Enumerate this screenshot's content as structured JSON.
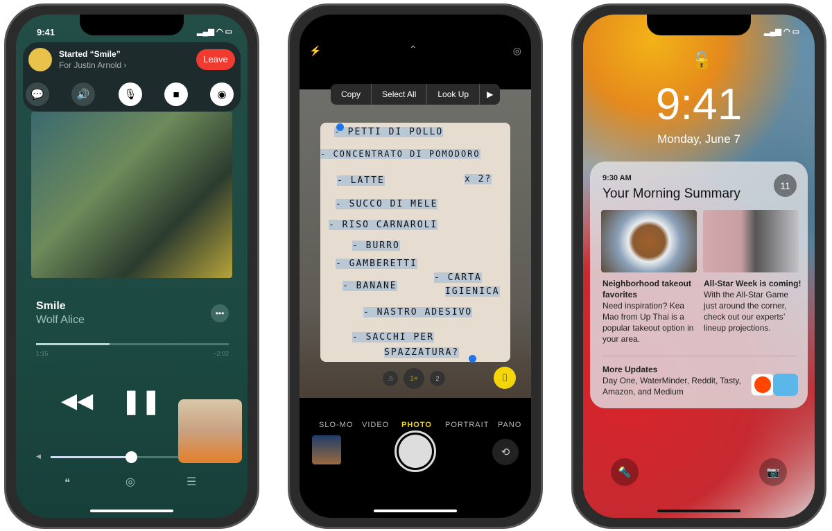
{
  "phone1": {
    "time": "9:41",
    "shareplay": {
      "title": "Started “Smile”",
      "subtitle": "For Justin Arnold ›",
      "leave_label": "Leave"
    },
    "controls": [
      "message-icon",
      "speaker-icon",
      "microphone-icon",
      "video-camera-icon",
      "shareplay-icon"
    ],
    "track": {
      "title": "Smile",
      "artist": "Wolf Alice",
      "elapsed": "1:15",
      "remaining": "−2:02",
      "progress": 0.38
    },
    "volume": 0.58,
    "bottom_icons": [
      "lyrics-icon",
      "airplay-icon",
      "queue-icon"
    ]
  },
  "phone2": {
    "menu": {
      "copy": "Copy",
      "select_all": "Select All",
      "look_up": "Look Up",
      "more": "▶"
    },
    "note_lines": [
      "- PETTI DI POLLO",
      "- CONCENTRATO DI POMODORO",
      "- LATTE",
      "x 2?",
      "- SUCCO DI MELE",
      "- RISO CARNAROLI",
      "- BURRO",
      "- GAMBERETTI",
      "- BANANE",
      "- CARTA",
      "IGIENICA",
      "- NASTRO ADESIVO",
      "- SACCHI PER",
      "SPAZZATURA?"
    ],
    "zoom": {
      "a": ".5",
      "b": "1×",
      "c": "2"
    },
    "modes": [
      "SLO-MO",
      "VIDEO",
      "PHOTO",
      "PORTRAIT",
      "PANO"
    ],
    "selected_mode": "PHOTO",
    "accent": "#f5d60a"
  },
  "phone3": {
    "time": "9:41",
    "date": "Monday, June 7",
    "summary": {
      "time": "9:30 AM",
      "title": "Your Morning Summary",
      "count": "11",
      "stories": [
        {
          "headline": "Neighborhood takeout favorites",
          "body": "Need inspiration? Kea Mao from Up Thai is a popular takeout option in your area."
        },
        {
          "headline": "All-Star Week is coming!",
          "body": "With the All-Star Game just around the corner, check out our experts’ lineup projections."
        }
      ],
      "more_title": "More Updates",
      "more_body": "Day One, WaterMinder, Reddit, Tasty, Amazon, and Medium"
    }
  }
}
